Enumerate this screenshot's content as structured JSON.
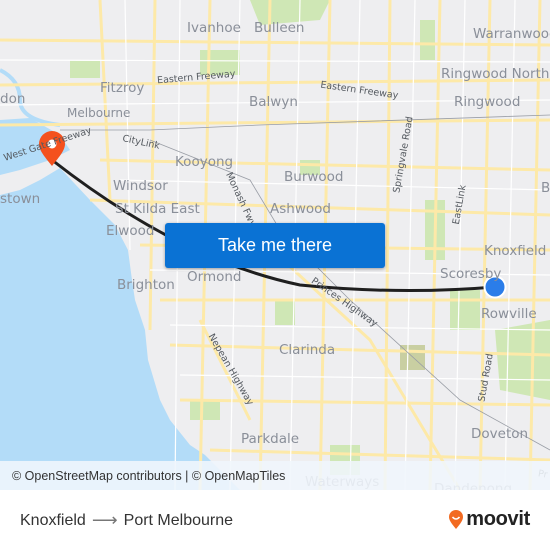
{
  "map": {
    "suburbs": [
      {
        "id": "ivanhoe",
        "label": "Ivanhoe"
      },
      {
        "id": "bulleen",
        "label": "Bulleen"
      },
      {
        "id": "warranwood",
        "label": "Warranwood"
      },
      {
        "id": "fitzroy",
        "label": "Fitzroy"
      },
      {
        "id": "ringwood-north",
        "label": "Ringwood North"
      },
      {
        "id": "melbourne",
        "label": "Melbourne"
      },
      {
        "id": "balwyn",
        "label": "Balwyn"
      },
      {
        "id": "ringwood",
        "label": "Ringwood"
      },
      {
        "id": "kooyong",
        "label": "Kooyong"
      },
      {
        "id": "windsor",
        "label": "Windsor"
      },
      {
        "id": "burwood",
        "label": "Burwood"
      },
      {
        "id": "st-kilda-east",
        "label": "St Kilda East"
      },
      {
        "id": "ashwood",
        "label": "Ashwood"
      },
      {
        "id": "elwood",
        "label": "Elwood"
      },
      {
        "id": "knoxfield",
        "label": "Knoxfield"
      },
      {
        "id": "ormond",
        "label": "Ormond"
      },
      {
        "id": "scoresby",
        "label": "Scoresby"
      },
      {
        "id": "brighton",
        "label": "Brighton"
      },
      {
        "id": "rowville",
        "label": "Rowville"
      },
      {
        "id": "clarinda",
        "label": "Clarinda"
      },
      {
        "id": "parkdale",
        "label": "Parkdale"
      },
      {
        "id": "doveton",
        "label": "Doveton"
      },
      {
        "id": "waterways",
        "label": "Waterways"
      },
      {
        "id": "dandenong",
        "label": "Dandenong"
      },
      {
        "id": "newport",
        "label": "don"
      },
      {
        "id": "williamstown",
        "label": "stown"
      },
      {
        "id": "edge-b",
        "label": "B"
      }
    ],
    "roads": [
      {
        "id": "eastern-freeway-1",
        "label": "Eastern Freeway"
      },
      {
        "id": "eastern-freeway-2",
        "label": "Eastern Freeway"
      },
      {
        "id": "citylink",
        "label": "CityLink"
      },
      {
        "id": "west-gate-freeway",
        "label": "West Gate Freeway"
      },
      {
        "id": "monash-freeway",
        "label": "Monash Fwy"
      },
      {
        "id": "springvale-road",
        "label": "Springvale Road"
      },
      {
        "id": "eastlink",
        "label": "EastLink"
      },
      {
        "id": "princes-highway",
        "label": "Princes Highway"
      },
      {
        "id": "nepean-highway",
        "label": "Nepean Highway"
      },
      {
        "id": "stud-road",
        "label": "Stud Road"
      },
      {
        "id": "princes-highway-edge",
        "label": "Pr"
      }
    ],
    "cta_button": "Take me there",
    "attribution": "© OpenStreetMap contributors | © OpenMapTiles",
    "origin_marker": "Knoxfield",
    "destination_marker": "Port Melbourne",
    "colors": {
      "water": "#b3dcf8",
      "land": "#eeeef0",
      "road": "#fde9a8",
      "park": "#cfe7b5",
      "route": "#1f1f1f",
      "origin": "#2b7de9",
      "destination": "#f4511e",
      "button": "#0a72d4"
    }
  },
  "footer": {
    "origin": "Knoxfield",
    "destination": "Port Melbourne",
    "brand": "moovit"
  }
}
